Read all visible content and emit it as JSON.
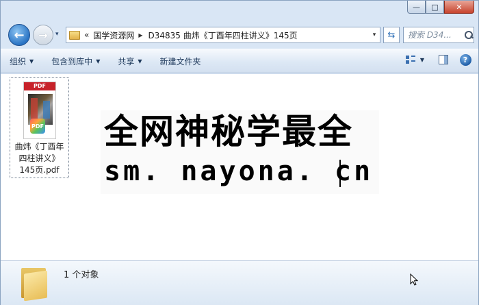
{
  "window": {
    "caption_minimize": "—",
    "caption_maximize": "□",
    "caption_close": "✕"
  },
  "nav": {
    "back_glyph": "←",
    "forward_glyph": "→",
    "history_glyph": "▾"
  },
  "address": {
    "overflow": "«",
    "crumbs": [
      "国学资源网",
      "D34835 曲炜《丁酉年四柱讲义》145页"
    ],
    "separator": "▶",
    "dropdown": "▾",
    "refresh_glyph": "⇆"
  },
  "search": {
    "placeholder": "搜索 D34..."
  },
  "toolbar": {
    "organize": "组织",
    "include_library": "包含到库中",
    "share": "共享",
    "new_folder": "新建文件夹",
    "menu_arrow": "▼",
    "help": "?"
  },
  "file": {
    "thumb_label": "PDF",
    "badge": "PDF",
    "name_lines": [
      "曲炜《丁酉年",
      "四柱讲义》",
      "145页.pdf"
    ]
  },
  "watermark": {
    "line1": "全网神秘学最全",
    "line2": "sm. nayona. cn"
  },
  "details": {
    "count": "1 个对象"
  }
}
